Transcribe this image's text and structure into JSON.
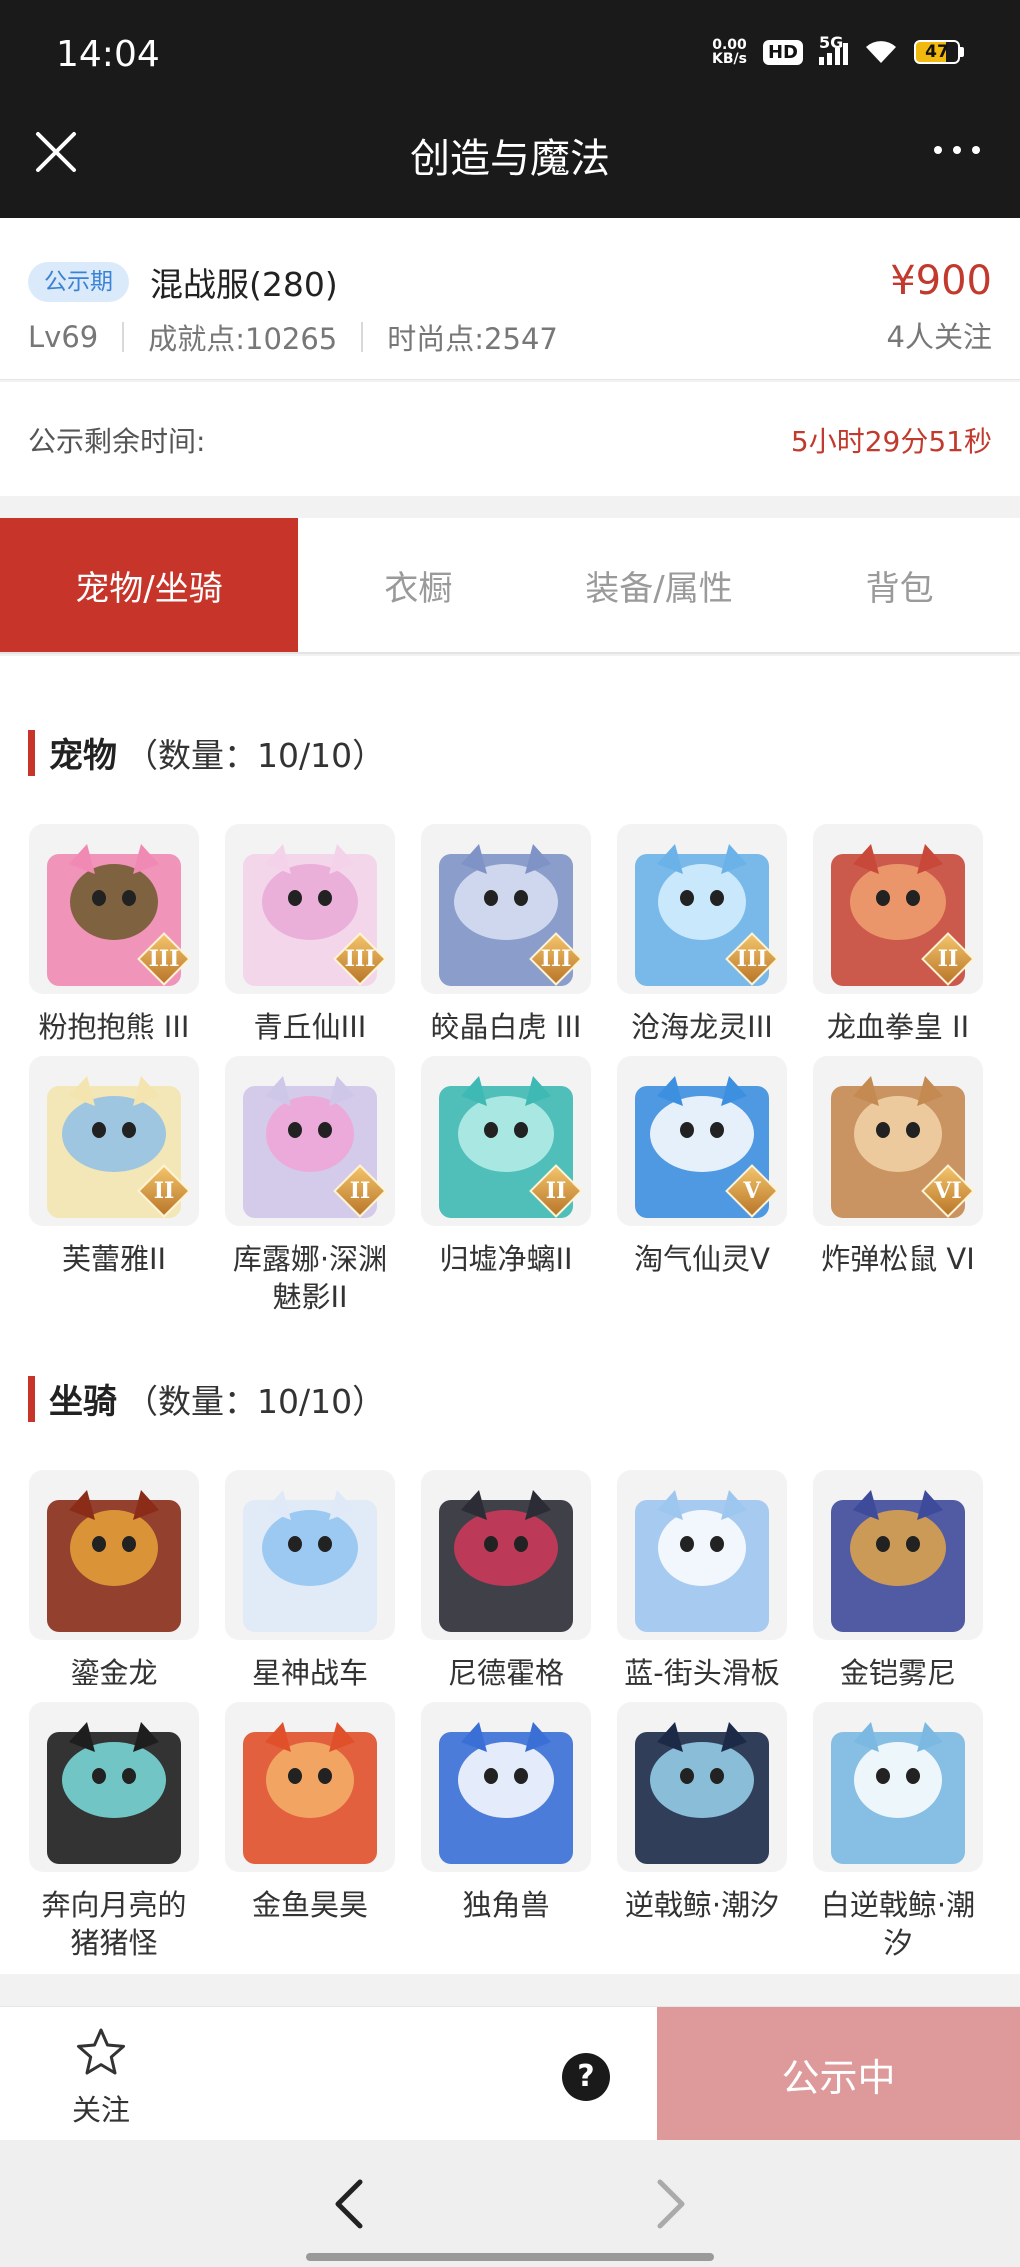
{
  "status_bar": {
    "time": "14:04",
    "net_speed_value": "0.00",
    "net_speed_unit": "KB/s",
    "hd_badge": "HD",
    "network": "5G",
    "battery": "47",
    "battery_color": "#f2b90f"
  },
  "header": {
    "title": "创造与魔法",
    "close_icon": "close-icon",
    "more_icon": "more-icon"
  },
  "listing": {
    "badge": "公示期",
    "server": "混战服(280)",
    "level": "Lv69",
    "achievement": "成就点:10265",
    "fashion": "时尚点:2547",
    "price": "¥900",
    "followers": "4人关注",
    "price_color": "#c23a2d"
  },
  "countdown": {
    "label": "公示剩余时间:",
    "value": "5小时29分51秒"
  },
  "tabs": [
    {
      "label": "宠物/坐骑",
      "active": true
    },
    {
      "label": "衣橱",
      "active": false
    },
    {
      "label": "装备/属性",
      "active": false
    },
    {
      "label": "背包",
      "active": false
    }
  ],
  "pets": {
    "title": "宠物",
    "count": "（数量：10/10）",
    "items": [
      {
        "name": "粉抱抱熊 III",
        "tier": "III"
      },
      {
        "name": "青丘仙III",
        "tier": "III"
      },
      {
        "name": "皎晶白虎 III",
        "tier": "III"
      },
      {
        "name": "沧海龙灵III",
        "tier": "III"
      },
      {
        "name": "龙血拳皇 II",
        "tier": "II"
      },
      {
        "name": "芙蕾雅II",
        "tier": "II"
      },
      {
        "name": "库露娜·深渊魅影II",
        "tier": "II"
      },
      {
        "name": "归墟净螭II",
        "tier": "II"
      },
      {
        "name": "淘气仙灵V",
        "tier": "V"
      },
      {
        "name": "炸弹松鼠 VI",
        "tier": "VI"
      }
    ]
  },
  "mounts": {
    "title": "坐骑",
    "count": "（数量：10/10）",
    "items": [
      {
        "name": "鎏金龙"
      },
      {
        "name": "星神战车"
      },
      {
        "name": "尼德霍格"
      },
      {
        "name": "蓝-街头滑板"
      },
      {
        "name": "金铠雾尼"
      },
      {
        "name": "奔向月亮的猪猪怪"
      },
      {
        "name": "金鱼昊昊"
      },
      {
        "name": "独角兽"
      },
      {
        "name": "逆戟鲸·潮汐"
      },
      {
        "name": "白逆戟鲸·潮汐"
      }
    ]
  },
  "actions": {
    "follow_label": "关注",
    "help_symbol": "?",
    "publicity_label": "公示中",
    "publicity_color": "#de9a9a"
  },
  "nav": {
    "back_icon": "chevron-left-icon",
    "forward_icon": "chevron-right-icon"
  }
}
